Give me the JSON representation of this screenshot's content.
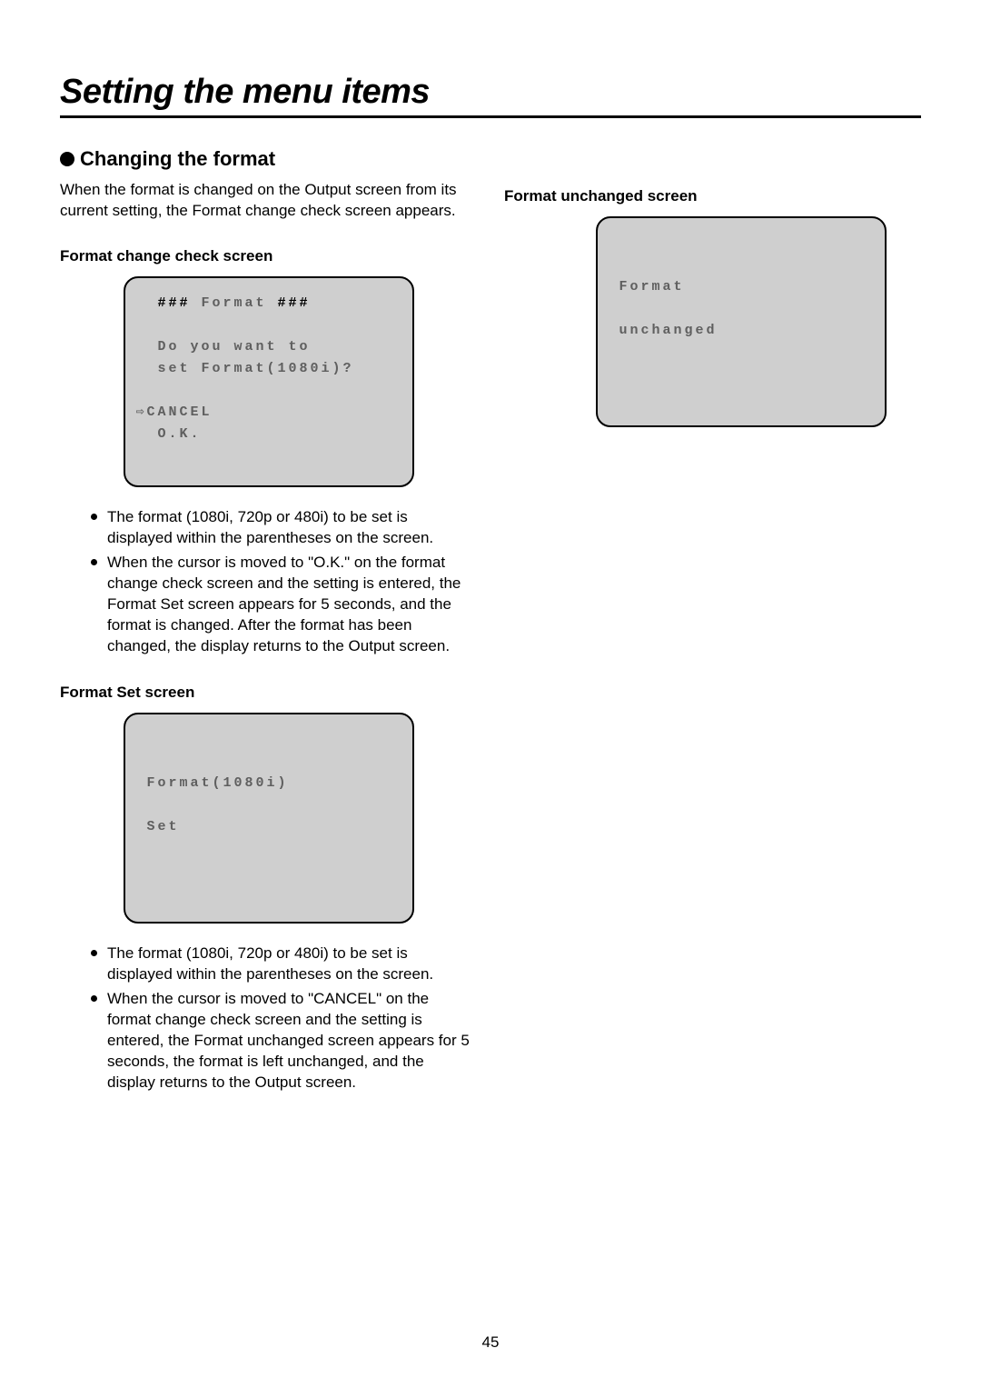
{
  "page": {
    "title": "Setting the menu items",
    "number": "45"
  },
  "section": {
    "heading": "Changing the format",
    "intro": "When the format is changed on the Output screen from its current setting, the Format change check screen appears."
  },
  "left": {
    "screen1_title": "Format change check screen",
    "screen1_text_plain": "  ### Format ###\n\n  Do you want to\n  set Format(1080i)?\n\n⇨CANCEL\n  O.K.",
    "screen1_l1a": "  ",
    "screen1_l1b": "###",
    "screen1_l1c": " Format ",
    "screen1_l1d": "###",
    "screen1_l3": "  Do you want to",
    "screen1_l4": "  set Format(1080i)?",
    "screen1_l6": "⇨CANCEL",
    "screen1_l7": "  O.K.",
    "bullets1": [
      "The format (1080i, 720p or 480i) to be set is displayed within the parentheses on the screen.",
      "When the cursor is moved to \"O.K.\" on the format change check screen and the setting is entered, the Format Set screen appears for 5 seconds, and the format is changed.\nAfter the format has been changed, the display returns to the Output screen."
    ],
    "screen2_title": "Format Set screen",
    "screen2_text": "\n\n Format(1080i)\n\n Set",
    "bullets2": [
      "The format (1080i, 720p or 480i) to be set is displayed within the parentheses on the screen.",
      "When the cursor is moved to \"CANCEL\" on the format change check screen and the setting is entered, the Format unchanged screen appears for 5 seconds, the format is left unchanged, and the display returns to the Output screen."
    ]
  },
  "right": {
    "screen_title": "Format unchanged screen",
    "screen_text": "\n\n Format\n\n unchanged"
  }
}
